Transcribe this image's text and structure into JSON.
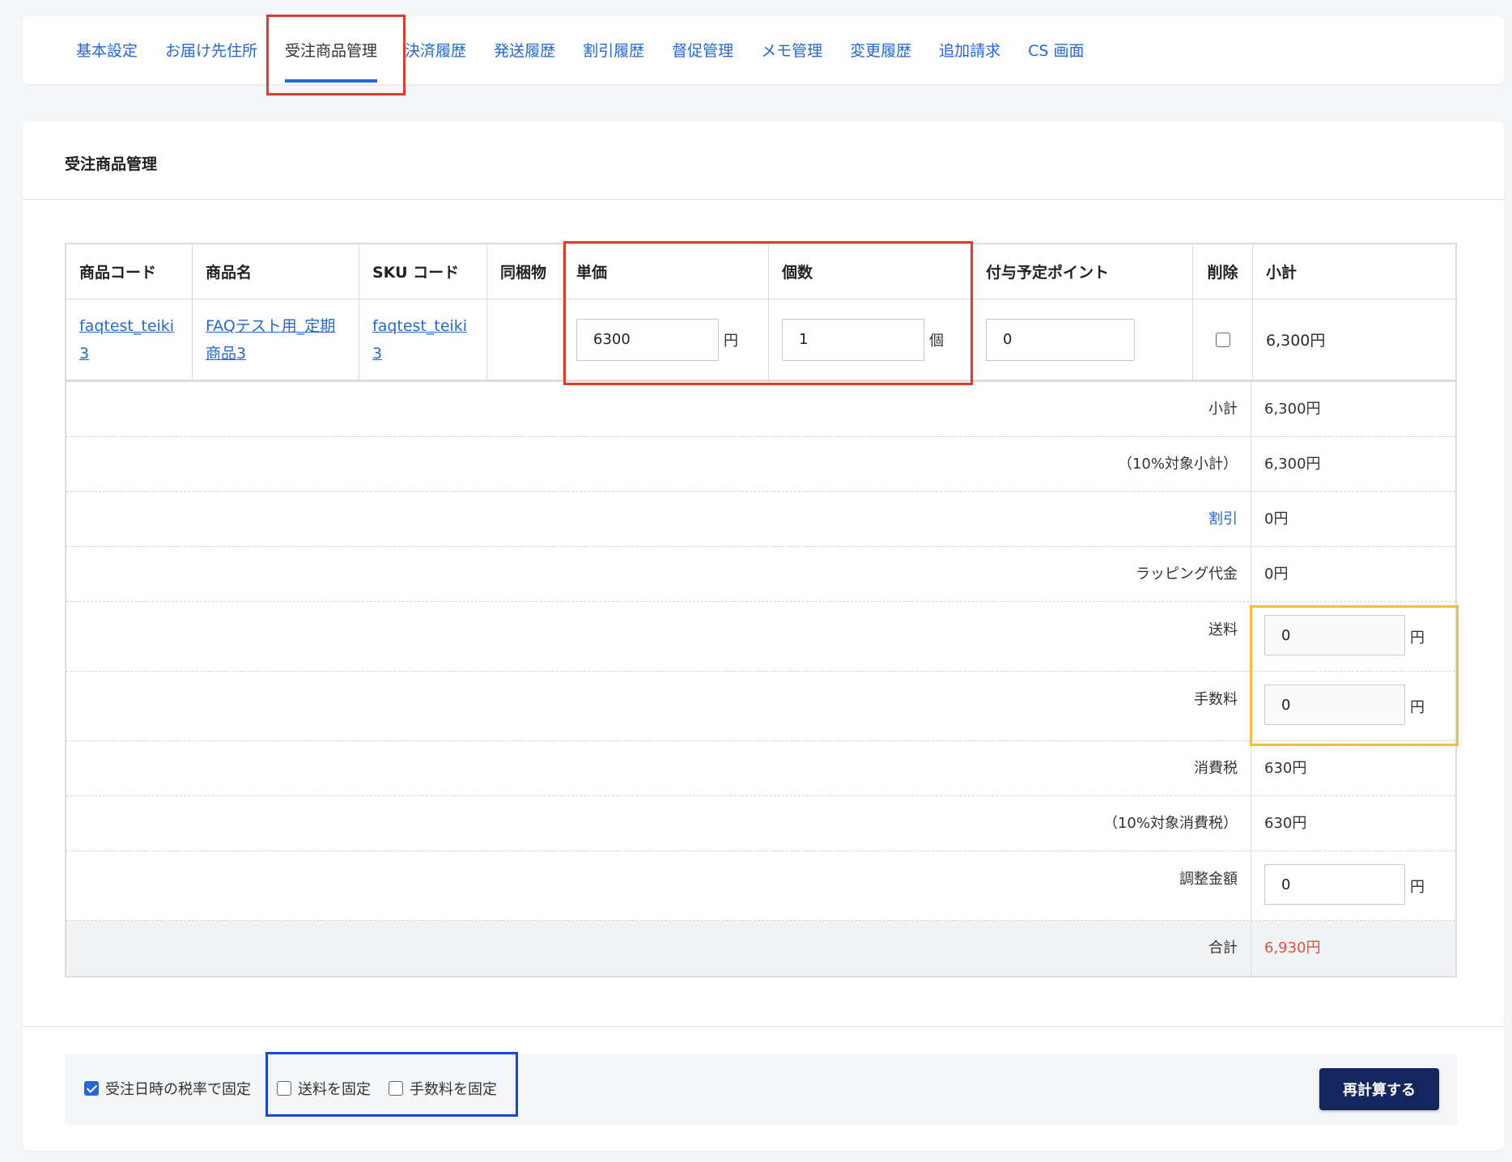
{
  "tabs": [
    {
      "label": "基本設定"
    },
    {
      "label": "お届け先住所"
    },
    {
      "label": "受注商品管理"
    },
    {
      "label": "決済履歴"
    },
    {
      "label": "発送履歴"
    },
    {
      "label": "割引履歴"
    },
    {
      "label": "督促管理"
    },
    {
      "label": "メモ管理"
    },
    {
      "label": "変更履歴"
    },
    {
      "label": "追加請求"
    },
    {
      "label": "CS 画面"
    }
  ],
  "active_tab": "受注商品管理",
  "section_title": "受注商品管理",
  "table": {
    "headers": [
      "商品コード",
      "商品名",
      "SKU コード",
      "同梱物",
      "単価",
      "個数",
      "付与予定ポイント",
      "削除",
      "小計"
    ],
    "item": {
      "product_code_line1": "faqtest_teiki",
      "product_code_line2": "3",
      "product_name_line1": "FAQテスト用_定期",
      "product_name_line2": "商品3",
      "sku_line1": "faqtest_teiki",
      "sku_line2": "3",
      "bundle": "",
      "unit_price": "6300",
      "unit_price_unit": "円",
      "quantity": "1",
      "quantity_unit": "個",
      "points": "0",
      "delete_checked": false,
      "subtotal": "6,300円"
    }
  },
  "summary": {
    "subtotal_label": "小計",
    "subtotal_value": "6,300円",
    "tax_base_label": "（10%対象小計）",
    "tax_base_value": "6,300円",
    "discount_label": "割引",
    "discount_value": "0円",
    "wrapping_label": "ラッピング代金",
    "wrapping_value": "0円",
    "shipping_label": "送料",
    "shipping_value": "0",
    "fee_label": "手数料",
    "fee_value": "0",
    "tax_label": "消費税",
    "tax_value": "630円",
    "tax10_label": "（10%対象消費税）",
    "tax10_value": "630円",
    "adjust_label": "調整金額",
    "adjust_value": "0",
    "yen": "円",
    "total_label": "合計",
    "total_value": "6,930円"
  },
  "footer": {
    "fix_tax_label": "受注日時の税率で固定",
    "fix_tax_checked": true,
    "fix_shipping_label": "送料を固定",
    "fix_shipping_checked": false,
    "fix_fee_label": "手数料を固定",
    "fix_fee_checked": false,
    "recalc_label": "再計算する"
  },
  "colors": {
    "link": "#2468d6",
    "highlight_red": "#e03c2b",
    "highlight_yellow": "#f5bd3c",
    "highlight_blue": "#1446e0",
    "total": "#e0503d",
    "button": "#13265e"
  }
}
